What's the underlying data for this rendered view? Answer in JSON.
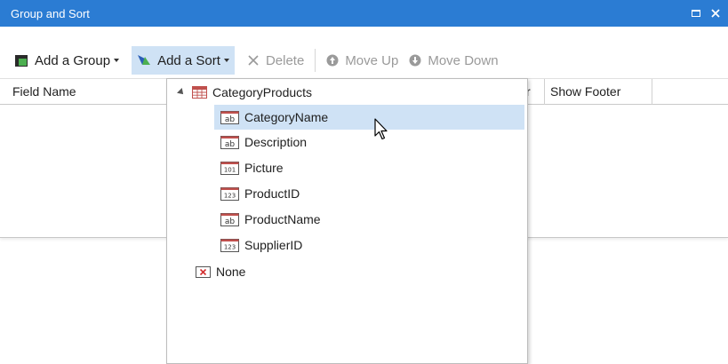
{
  "window": {
    "title": "Group and Sort"
  },
  "toolbar": {
    "add_group": "Add a Group",
    "add_sort": "Add a Sort",
    "delete": "Delete",
    "move_up": "Move Up",
    "move_down": "Move Down"
  },
  "grid": {
    "columns": [
      "Field Name",
      "r",
      "Show Footer"
    ]
  },
  "dropdown": {
    "root": "CategoryProducts",
    "fields": [
      {
        "label": "CategoryName",
        "type": "ab",
        "selected": true
      },
      {
        "label": "Description",
        "type": "ab",
        "selected": false
      },
      {
        "label": "Picture",
        "type": "101",
        "selected": false
      },
      {
        "label": "ProductID",
        "type": "123",
        "selected": false
      },
      {
        "label": "ProductName",
        "type": "ab",
        "selected": false
      },
      {
        "label": "SupplierID",
        "type": "123",
        "selected": false
      }
    ],
    "none_label": "None"
  },
  "colors": {
    "title_bar": "#2b7cd3",
    "selection": "#cfe2f5",
    "field_icon_accent": "#c0504d"
  }
}
